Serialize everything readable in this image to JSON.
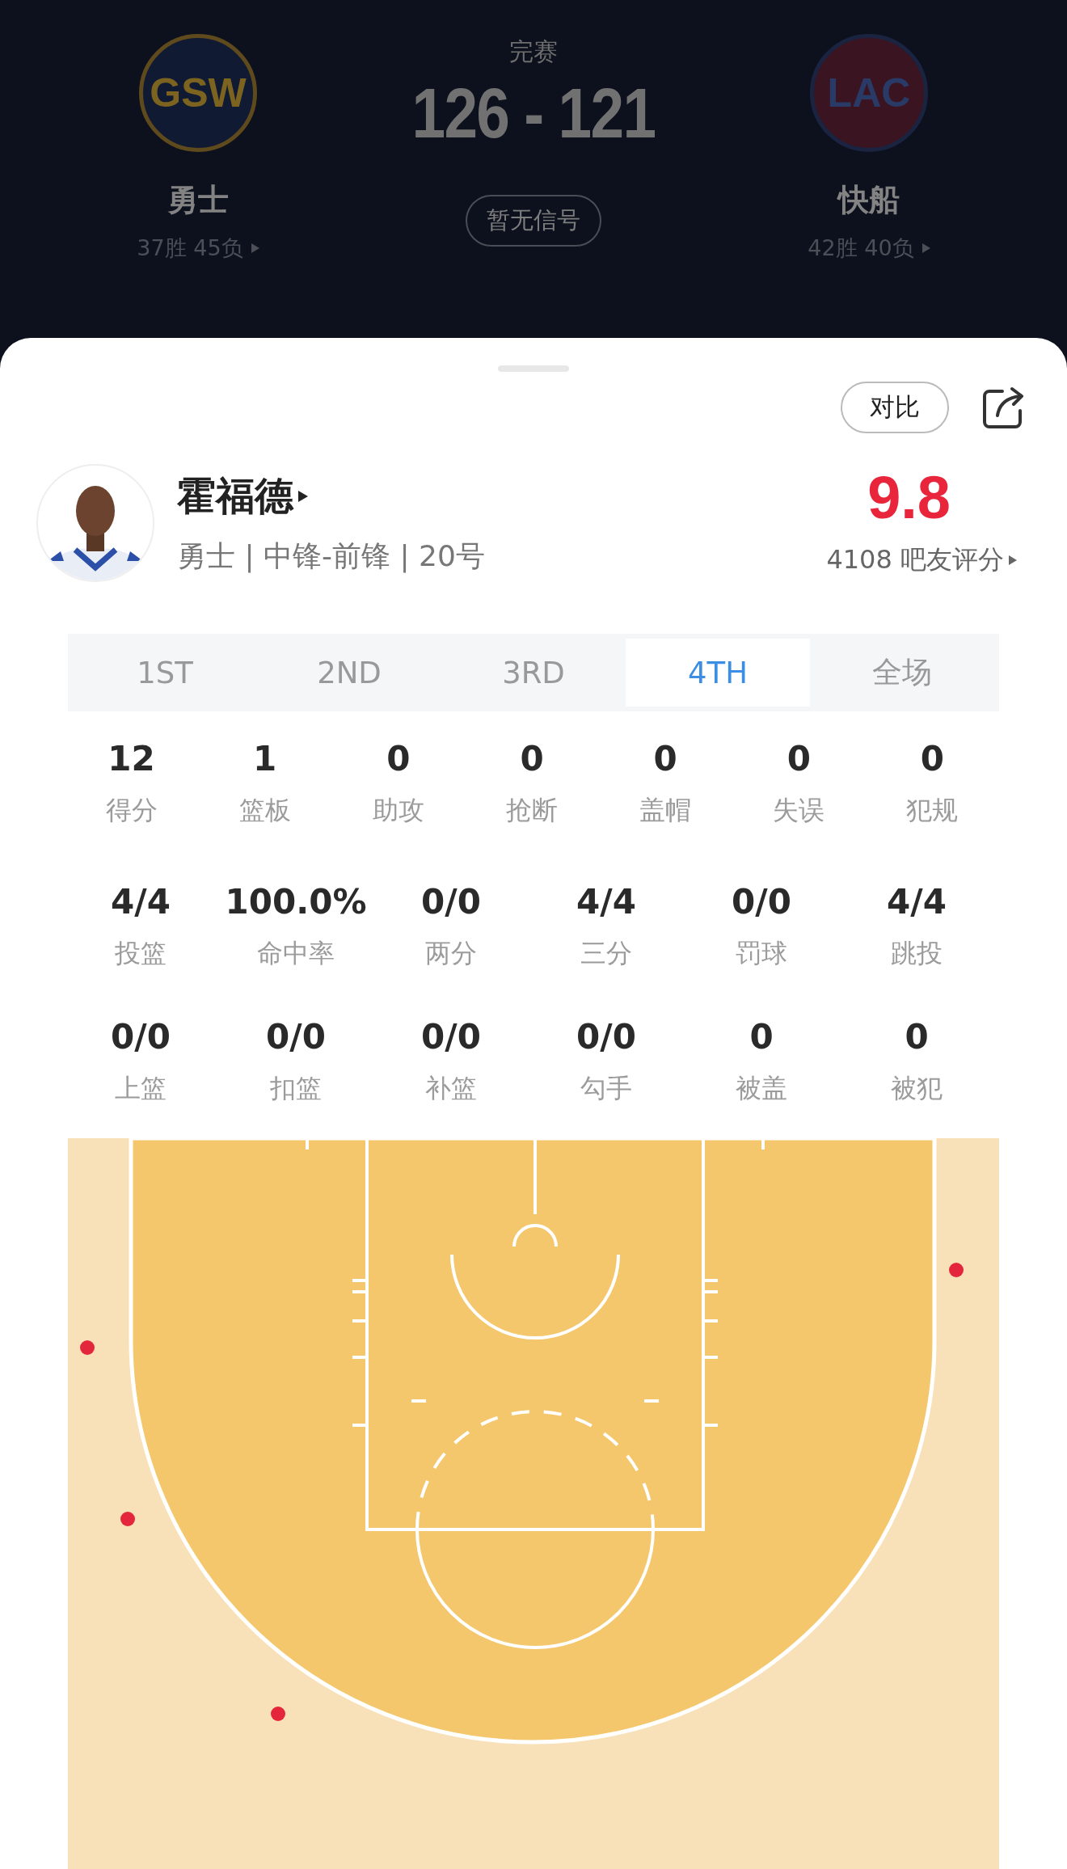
{
  "game": {
    "status": "完赛",
    "score": "126 - 121",
    "signal_button": "暂无信号"
  },
  "teams": [
    {
      "logo_text": "GSW",
      "name": "勇士",
      "record": "37胜 45负"
    },
    {
      "logo_text": "LAC",
      "name": "快船",
      "record": "42胜 40负"
    }
  ],
  "actions": {
    "compare_button": "对比"
  },
  "player": {
    "name": "霍福德",
    "info": "勇士 | 中锋-前锋 | 20号",
    "rating": "9.8",
    "rating_count": "4108 吧友评分"
  },
  "tabs": [
    {
      "label": "1ST",
      "selected": false
    },
    {
      "label": "2ND",
      "selected": false
    },
    {
      "label": "3RD",
      "selected": false
    },
    {
      "label": "4TH",
      "selected": true
    },
    {
      "label": "全场",
      "selected": false
    }
  ],
  "main_stats": [
    {
      "value": "12",
      "label": "得分"
    },
    {
      "value": "1",
      "label": "篮板"
    },
    {
      "value": "0",
      "label": "助攻"
    },
    {
      "value": "0",
      "label": "抢断"
    },
    {
      "value": "0",
      "label": "盖帽"
    },
    {
      "value": "0",
      "label": "失误"
    },
    {
      "value": "0",
      "label": "犯规"
    }
  ],
  "shooting_stats": [
    {
      "value": "4/4",
      "label": "投篮"
    },
    {
      "value": "100.0%",
      "label": "命中率"
    },
    {
      "value": "0/0",
      "label": "两分"
    },
    {
      "value": "4/4",
      "label": "三分"
    },
    {
      "value": "0/0",
      "label": "罚球"
    },
    {
      "value": "4/4",
      "label": "跳投"
    },
    {
      "value": "0/0",
      "label": "上篮"
    },
    {
      "value": "0/0",
      "label": "扣篮"
    },
    {
      "value": "0/0",
      "label": "补篮"
    },
    {
      "value": "0/0",
      "label": "勾手"
    },
    {
      "value": "0",
      "label": "被盖"
    },
    {
      "value": "0",
      "label": "被犯"
    }
  ],
  "shot_chart": {
    "shots": [
      {
        "made": true
      },
      {
        "made": true
      },
      {
        "made": true
      },
      {
        "made": true
      }
    ]
  }
}
